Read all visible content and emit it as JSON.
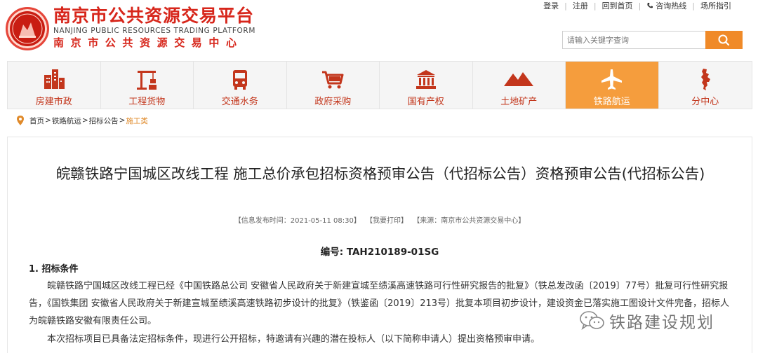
{
  "header": {
    "brand_cn": "南京市公共资源交易平台",
    "brand_en": "NANJING PUBLIC RESOURCES TRADING PLATFORM",
    "brand_center": "南京市公共资源交易中心"
  },
  "toplinks": {
    "login": "登录",
    "register": "注册",
    "home": "回到首页",
    "hotline": "咨询热线",
    "guide": "场所指引"
  },
  "search": {
    "placeholder": "请输入关键字查询"
  },
  "nav": {
    "items": [
      {
        "label": "房建市政",
        "icon": "building-icon"
      },
      {
        "label": "工程货物",
        "icon": "crane-icon"
      },
      {
        "label": "交通水务",
        "icon": "bus-icon"
      },
      {
        "label": "政府采购",
        "icon": "cart-icon"
      },
      {
        "label": "国有产权",
        "icon": "bank-icon"
      },
      {
        "label": "土地矿产",
        "icon": "mountain-icon"
      },
      {
        "label": "铁路航运",
        "icon": "airplane-icon",
        "active": true
      },
      {
        "label": "分中心",
        "icon": "map-icon"
      }
    ]
  },
  "breadcrumb": {
    "home": "首页",
    "c1": "铁路航运",
    "c2": "招标公告",
    "current": "施工类",
    "sep": ">"
  },
  "article": {
    "title": "皖赣铁路宁国城区改线工程 施工总价承包招标资格预审公告（代招标公告）资格预审公告(代招标公告)",
    "meta_time": "【信息发布时间：2021-05-11 08:30】",
    "meta_print": "【我要打印】",
    "meta_source": "【来源：南京市公共资源交易中心】",
    "doc_number": "编号: TAH210189-01SG",
    "section1_heading": "1.  招标条件",
    "para1": "皖赣铁路宁国城区改线工程已经《中国铁路总公司 安徽省人民政府关于新建宣城至绩溪高速铁路可行性研究报告的批复》（铁总发改函〔2019〕77号）批复可行性研究报告，《国铁集团 安徽省人民政府关于新建宣城至绩溪高速铁路初步设计的批复》（铁鉴函〔2019〕213号）批复本项目初步设计，建设资金已落实施工图设计文件完备，招标人为皖赣铁路安徽有限责任公司。",
    "para2": "本次招标项目已具备法定招标条件，现进行公开招标，特邀请有兴趣的潜在投标人（以下简称申请人）提出资格预审申请。"
  },
  "watermark": {
    "text": "铁路建设规划"
  },
  "colors": {
    "brand_red": "#d7261b",
    "accent_orange": "#f59d3d",
    "nav_label": "#c3361c"
  }
}
